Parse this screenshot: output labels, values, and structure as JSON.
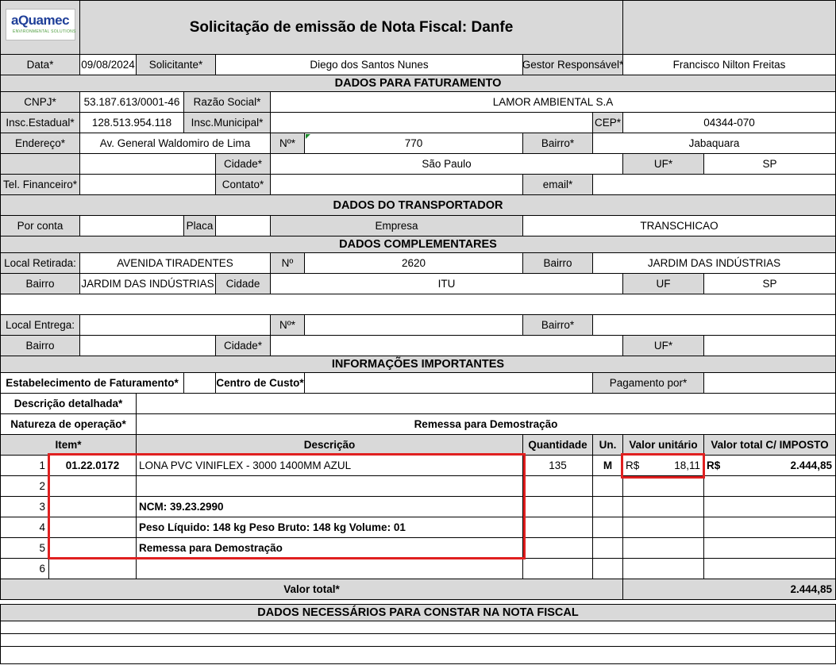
{
  "header": {
    "logo_text": "aQuamec",
    "logo_sub": "ENVIRONMENTAL SOLUTIONS",
    "title": "Solicitação de emissão de Nota Fiscal: Danfe"
  },
  "request": {
    "data_label": "Data*",
    "data_value": "09/08/2024",
    "solicitante_label": "Solicitante*",
    "solicitante_value": "Diego dos Santos Nunes",
    "gestor_label": "Gestor Responsável*",
    "gestor_value": "Francisco Nilton Freitas"
  },
  "faturamento": {
    "heading": "DADOS PARA FATURAMENTO",
    "cnpj_label": "CNPJ*",
    "cnpj_value": "53.187.613/0001-46",
    "razao_label": "Razão Social*",
    "razao_value": "LAMOR AMBIENTAL S.A",
    "ie_label": "Insc.Estadual*",
    "ie_value": "128.513.954.118",
    "im_label": "Insc.Municipal*",
    "im_value": "",
    "cep_label": "CEP*",
    "cep_value": "04344-070",
    "endereco_label": "Endereço*",
    "endereco_value": "Av. General Waldomiro de Lima",
    "numero_label": "Nº*",
    "numero_value": "770",
    "bairro_label": "Bairro*",
    "bairro_value": "Jabaquara",
    "cidade_label": "Cidade*",
    "cidade_value": "São Paulo",
    "uf_label": "UF*",
    "uf_value": "SP",
    "tel_label": "Tel. Financeiro*",
    "tel_value": "",
    "contato_label": "Contato*",
    "contato_value": "",
    "email_label": "email*",
    "email_value": ""
  },
  "transportador": {
    "heading": "DADOS DO TRANSPORTADOR",
    "porconta_label": "Por conta",
    "porconta_value": "",
    "placa_label": "Placa",
    "placa_value": "",
    "empresa_label": "Empresa",
    "empresa_value": "TRANSCHICAO"
  },
  "complementares": {
    "heading": "DADOS COMPLEMENTARES",
    "retirada_label": "Local Retirada:",
    "retirada_value": "AVENIDA TIRADENTES",
    "r_numero_label": "Nº",
    "r_numero_value": "2620",
    "r_bairro_label": "Bairro",
    "r_bairro_value": "JARDIM DAS INDÚSTRIAS",
    "r_bairro2_label": "Bairro",
    "r_bairro2_value": "JARDIM DAS INDÚSTRIAS",
    "r_cidade_label": "Cidade",
    "r_cidade_value": "ITU",
    "r_uf_label": "UF",
    "r_uf_value": "SP",
    "entrega_label": "Local Entrega:",
    "e_numero_label": "Nº*",
    "e_bairro_label": "Bairro*",
    "e_bairro2_label": "Bairro",
    "e_cidade_label": "Cidade*",
    "e_uf_label": "UF*"
  },
  "informacoes": {
    "heading": "INFORMAÇÕES IMPORTANTES",
    "estab_label": "Estabelecimento de Faturamento*",
    "centro_label": "Centro de Custo*",
    "pagamento_label": "Pagamento por*",
    "descricao_label": "Descrição detalhada*",
    "natureza_label": "Natureza de operação*",
    "natureza_value": "Remessa para Demostração"
  },
  "items_table": {
    "headers": {
      "item": "Item*",
      "descricao": "Descrição",
      "quantidade": "Quantidade",
      "un": "Un.",
      "valor_unitario": "Valor unitário",
      "valor_total": "Valor total C/ IMPOSTO"
    },
    "rows": [
      {
        "n": "1",
        "code": "01.22.0172",
        "desc": "LONA PVC VINIFLEX - 3000 1400MM AZUL",
        "qty": "135",
        "un": "M",
        "vu_cur": "R$",
        "vu": "18,11",
        "vt_cur": "R$",
        "vt": "2.444,85"
      },
      {
        "n": "2",
        "code": "",
        "desc": "",
        "qty": "",
        "un": "",
        "vu_cur": "",
        "vu": "",
        "vt_cur": "",
        "vt": ""
      },
      {
        "n": "3",
        "code": "",
        "desc": "NCM: 39.23.2990",
        "qty": "",
        "un": "",
        "vu_cur": "",
        "vu": "",
        "vt_cur": "",
        "vt": ""
      },
      {
        "n": "4",
        "code": "",
        "desc": "Peso Líquido: 148 kg Peso Bruto: 148 kg  Volume: 01",
        "qty": "",
        "un": "",
        "vu_cur": "",
        "vu": "",
        "vt_cur": "",
        "vt": ""
      },
      {
        "n": "5",
        "code": "",
        "desc": "Remessa para Demostração",
        "qty": "",
        "un": "",
        "vu_cur": "",
        "vu": "",
        "vt_cur": "",
        "vt": ""
      },
      {
        "n": "6",
        "code": "",
        "desc": "",
        "qty": "",
        "un": "",
        "vu_cur": "",
        "vu": "",
        "vt_cur": "",
        "vt": ""
      }
    ],
    "valor_total_label": "Valor total*",
    "valor_total_value": "2.444,85"
  },
  "nota_fiscal": {
    "heading": "DADOS NECESSÁRIOS PARA CONSTAR NA NOTA FISCAL"
  },
  "colors": {
    "header_gray": "#d9d9d9",
    "highlight_red": "#e02020",
    "logo_blue": "#1f3f99"
  }
}
